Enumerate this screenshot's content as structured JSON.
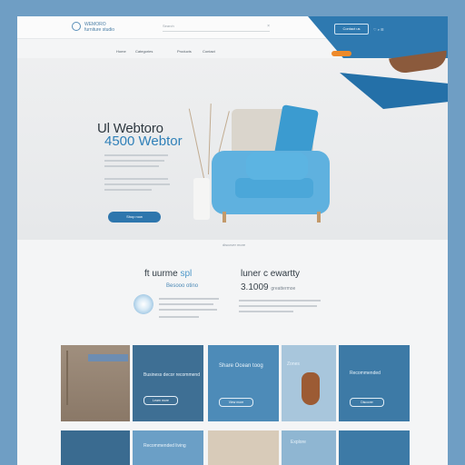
{
  "header": {
    "brand": "WEMORO",
    "brand_sub": "furniture studio",
    "search_placeholder": "Search",
    "search_clear": "×",
    "top_button": "Contact us",
    "top_icons": "♡ ⌕ ☰"
  },
  "nav": {
    "items": [
      "Home",
      "Categories",
      "Products",
      "Contact"
    ],
    "cta": ""
  },
  "hero": {
    "title_line1": "Ul Webtoro",
    "title_line2": "4500 Webtor",
    "cta": "Shop now",
    "caption": "discover more"
  },
  "feature": {
    "left_title": "ft uurme ",
    "left_accent": "spl",
    "left_sub": "Besooo otino",
    "right_title": "luner c ewartty",
    "right_sub_big": "3.1009",
    "right_sub_small": "greattermoe"
  },
  "tiles": [
    {
      "label": "",
      "button": ""
    },
    {
      "label": "Business decor recommend",
      "button": "Learn more"
    },
    {
      "label": "Share Ocean toog",
      "button": "View more"
    },
    {
      "label": "Zones",
      "button": ""
    },
    {
      "label": "Recommended",
      "button": "Discover"
    }
  ],
  "row2": [
    {
      "label": ""
    },
    {
      "label": "Recommended living"
    },
    {
      "label": ""
    },
    {
      "label": "Explore"
    },
    {
      "label": ""
    }
  ],
  "colors": {
    "accent": "#2e79b0",
    "orange": "#ee8a2a"
  }
}
